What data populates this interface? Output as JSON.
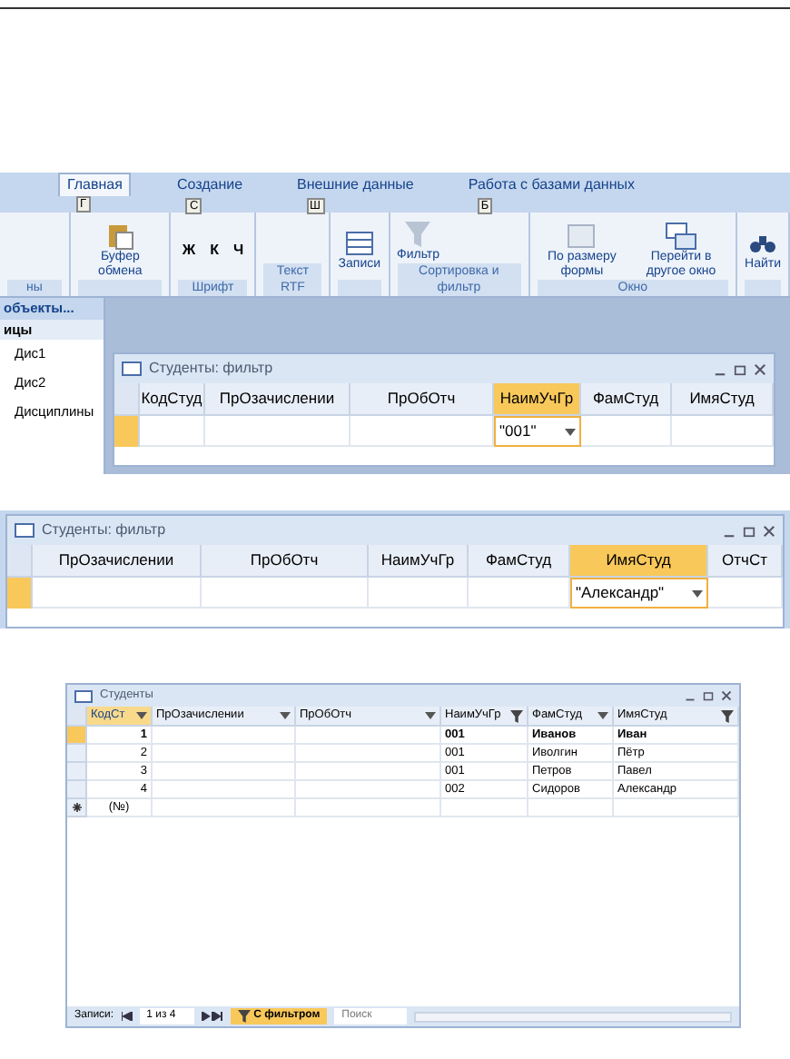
{
  "ribbon": {
    "tabs": [
      {
        "label": "Главная",
        "keytip": "Г",
        "selected": true
      },
      {
        "label": "Создание",
        "keytip": "С",
        "selected": false
      },
      {
        "label": "Внешние данные",
        "keytip": "Ш",
        "selected": false
      },
      {
        "label": "Работа с базами данных",
        "keytip": "Б",
        "selected": false
      }
    ],
    "groups": [
      {
        "label": "ны"
      },
      {
        "buttons": [
          {
            "label": "Буфер обмена",
            "kind": "clipboard"
          }
        ]
      },
      {
        "label": "Шрифт",
        "buttons": [
          {
            "label": "Ж",
            "kind": "format"
          },
          {
            "label": "К",
            "kind": "format"
          },
          {
            "label": "Ч",
            "kind": "format"
          }
        ]
      },
      {
        "label": "Текст RTF"
      },
      {
        "buttons": [
          {
            "label": "Записи",
            "kind": "records"
          }
        ]
      },
      {
        "label": "Сортировка и фильтр",
        "buttons": [
          {
            "label": "Фильтр",
            "kind": "filter"
          }
        ]
      },
      {
        "label": "Окно",
        "buttons": [
          {
            "label": "По размеру формы",
            "kind": "fit"
          },
          {
            "label": "Перейти в другое окно",
            "kind": "windows"
          }
        ]
      },
      {
        "buttons": [
          {
            "label": "Найти",
            "kind": "find"
          }
        ]
      }
    ]
  },
  "nav_pane": {
    "header": "объекты...",
    "section": "ицы",
    "items": [
      "Дис1",
      "Дис2",
      "Дисциплины"
    ]
  },
  "filter_window_1": {
    "title": "Студенты: фильтр",
    "columns": [
      {
        "label": "КодСтуд",
        "selected": false
      },
      {
        "label": "ПрОзачислении",
        "selected": false
      },
      {
        "label": "ПрОбОтч",
        "selected": false
      },
      {
        "label": "НаимУчГр",
        "selected": true,
        "value": "\"001\""
      },
      {
        "label": "ФамСтуд",
        "selected": false
      },
      {
        "label": "ИмяСтуд",
        "selected": false
      }
    ]
  },
  "filter_window_2": {
    "title": "Студенты: фильтр",
    "columns": [
      {
        "label": "ПрОзачислении",
        "selected": false
      },
      {
        "label": "ПрОбОтч",
        "selected": false
      },
      {
        "label": "НаимУчГр",
        "selected": false
      },
      {
        "label": "ФамСтуд",
        "selected": false
      },
      {
        "label": "ИмяСтуд",
        "selected": true,
        "value": "\"Александр\""
      },
      {
        "label": "ОтчСт",
        "selected": false
      }
    ]
  },
  "table_window": {
    "title": "Студенты",
    "columns": [
      {
        "label": "КодСт",
        "selected": true,
        "filtered": false
      },
      {
        "label": "ПрОзачислении",
        "selected": false,
        "filtered": false
      },
      {
        "label": "ПрОбОтч",
        "selected": false,
        "filtered": false
      },
      {
        "label": "НаимУчГр",
        "selected": false,
        "filtered": true
      },
      {
        "label": "ФамСтуд",
        "selected": false,
        "filtered": false
      },
      {
        "label": "ИмяСтуд",
        "selected": false,
        "filtered": true
      }
    ],
    "rows": [
      {
        "selected": true,
        "cells": [
          "1",
          null,
          null,
          "001",
          "Иванов",
          "Иван"
        ]
      },
      {
        "selected": false,
        "cells": [
          "2",
          null,
          null,
          "001",
          "Иволгин",
          "Пётр"
        ]
      },
      {
        "selected": false,
        "cells": [
          "3",
          null,
          null,
          "001",
          "Петров",
          "Павел"
        ]
      },
      {
        "selected": false,
        "cells": [
          "4",
          null,
          null,
          "002",
          "Сидоров",
          "Александр"
        ]
      }
    ],
    "new_row": "(№)",
    "status": {
      "label": "Записи:",
      "position": "1 из 4",
      "filter": "С фильтром",
      "search": "Поиск"
    }
  }
}
